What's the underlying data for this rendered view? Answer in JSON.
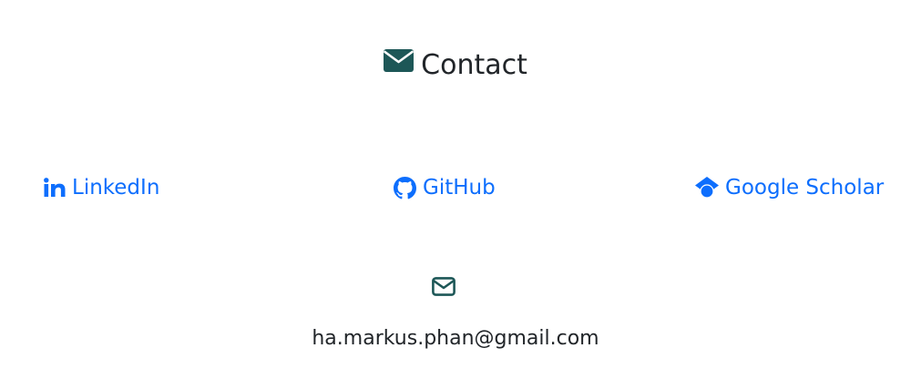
{
  "contact": {
    "title": "Contact",
    "title_icon": "envelope-icon",
    "icon_color": "#1d5757"
  },
  "links": {
    "linkedin": {
      "label": "LinkedIn",
      "icon": "linkedin-icon"
    },
    "github": {
      "label": "GitHub",
      "icon": "github-icon"
    },
    "scholar": {
      "label": "Google Scholar",
      "icon": "graduation-cap-icon"
    },
    "color": "#0d6efd"
  },
  "email": {
    "icon": "envelope-outline-icon",
    "address": "ha.markus.phan@gmail.com"
  }
}
